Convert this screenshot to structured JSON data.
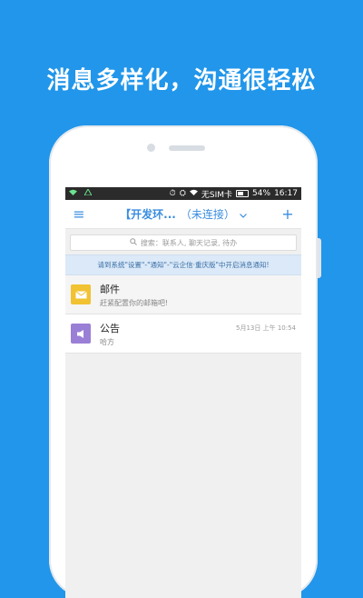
{
  "promo": {
    "headline": "消息多样化，沟通很轻松"
  },
  "status_bar": {
    "sim": "无SIM卡",
    "battery": "54%",
    "time": "16:17"
  },
  "app_bar": {
    "title": "【开发环...",
    "connection": "（未连接）"
  },
  "search": {
    "placeholder": "搜索：联系人, 聊天记录, 待办"
  },
  "notice": {
    "text": "请到系统\"设置\"-\"通知\"-\"云企信·重庆版\"中开启消息通知!"
  },
  "conversations": [
    {
      "title": "邮件",
      "subtitle": "赶紧配置你的邮箱吧!",
      "time": "",
      "icon": "mail-icon",
      "color": "#f1c232"
    },
    {
      "title": "公告",
      "subtitle": "哈方",
      "time": "5月13日 上午 10:54",
      "icon": "speaker-icon",
      "color": "#9a7fd6"
    }
  ],
  "colors": {
    "background": "#2196ea",
    "accent": "#3a8de0"
  }
}
